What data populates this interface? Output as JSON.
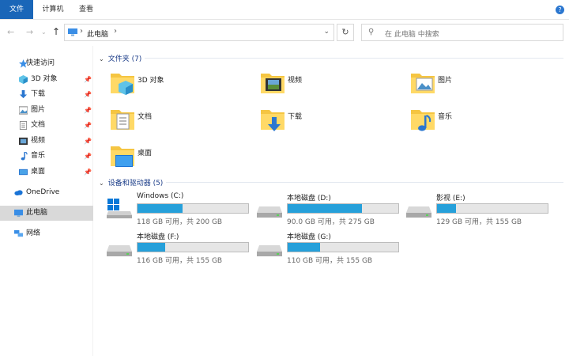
{
  "ribbon": {
    "tabs": [
      "文件",
      "计算机",
      "查看"
    ],
    "help": "?"
  },
  "nav": {
    "address_crumb": "此电脑",
    "sep": "›",
    "dropdown": "⌄",
    "refresh": "↻",
    "search_placeholder": "在 此电脑 中搜索"
  },
  "sidebar": {
    "quick_access": "快速访问",
    "quick_items": [
      {
        "label": "3D 对象",
        "icon": "3d-objects-icon"
      },
      {
        "label": "下载",
        "icon": "downloads-icon"
      },
      {
        "label": "图片",
        "icon": "pictures-icon"
      },
      {
        "label": "文档",
        "icon": "documents-icon"
      },
      {
        "label": "视频",
        "icon": "videos-icon"
      },
      {
        "label": "音乐",
        "icon": "music-icon"
      },
      {
        "label": "桌面",
        "icon": "desktop-icon"
      }
    ],
    "onedrive": "OneDrive",
    "this_pc": "此电脑",
    "network": "网络"
  },
  "main": {
    "folders_header": "文件夹 (7)",
    "folders": [
      "3D 对象",
      "视频",
      "图片",
      "文档",
      "下载",
      "音乐",
      "桌面"
    ],
    "drives_header": "设备和驱动器 (5)",
    "drives": [
      {
        "name": "Windows (C:)",
        "info": "118 GB 可用，共 200 GB",
        "used": 0.41
      },
      {
        "name": "本地磁盘 (D:)",
        "info": "90.0 GB 可用，共 275 GB",
        "used": 0.67
      },
      {
        "name": "影视 (E:)",
        "info": "129 GB 可用，共 155 GB",
        "used": 0.17
      },
      {
        "name": "本地磁盘 (F:)",
        "info": "116 GB 可用，共 155 GB",
        "used": 0.25
      },
      {
        "name": "本地磁盘 (G:)",
        "info": "110 GB 可用，共 155 GB",
        "used": 0.29
      }
    ]
  },
  "colors": {
    "accent": "#1a66b8",
    "drive_fill": "#26a0da",
    "folder": "#f5c542",
    "header_text": "#1e3f8a"
  }
}
